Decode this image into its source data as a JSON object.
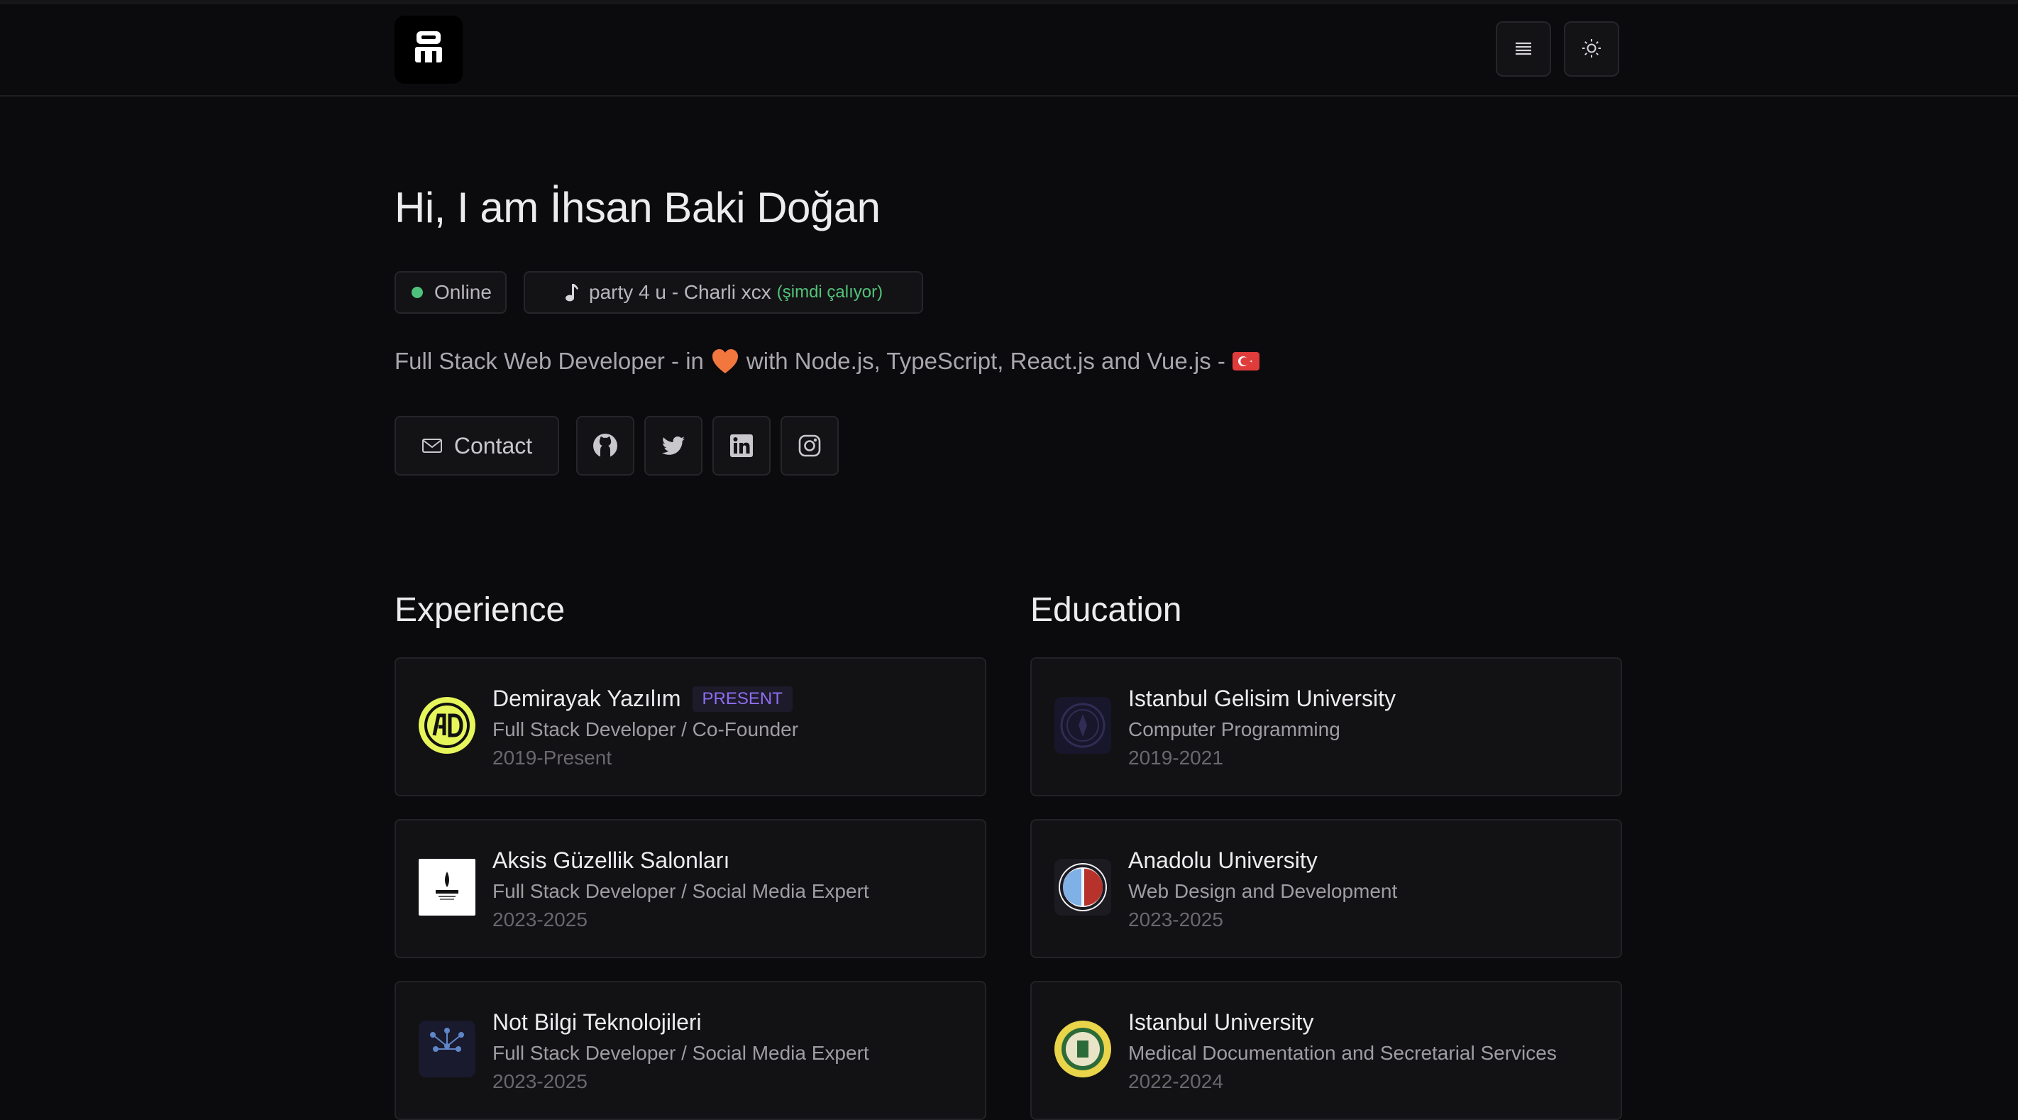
{
  "header": {
    "logo_icon": "robot-logo-icon",
    "menu_icon": "menu-icon",
    "theme_icon": "sun-icon"
  },
  "hero": {
    "title": "Hi, I am İhsan Baki Doğan",
    "status": {
      "label": "Online",
      "color": "#4ec27d"
    },
    "now_playing": {
      "track": "party 4 u - Charli xcx",
      "status": "(şimdi çalıyor)",
      "icon": "music-note-icon"
    },
    "bio": {
      "before": "Full Stack Web Developer - in",
      "heart_icon": "heart-icon",
      "after": "with Node.js, TypeScript, React.js and Vue.js -",
      "flag_icon": "turkey-flag-icon"
    },
    "contact_label": "Contact",
    "socials": [
      "github-icon",
      "twitter-icon",
      "linkedin-icon",
      "instagram-icon"
    ]
  },
  "experience": {
    "title": "Experience",
    "items": [
      {
        "name": "Demirayak Yazılım",
        "badge": "PRESENT",
        "role": "Full Stack Developer / Co-Founder",
        "years": "2019-Present"
      },
      {
        "name": "Aksis Güzellik Salonları",
        "role": "Full Stack Developer / Social Media Expert",
        "years": "2023-2025"
      },
      {
        "name": "Not Bilgi Teknolojileri",
        "role": "Full Stack Developer / Social Media Expert",
        "years": "2023-2025"
      }
    ]
  },
  "education": {
    "title": "Education",
    "items": [
      {
        "name": "Istanbul Gelisim University",
        "role": "Computer Programming",
        "years": "2019-2021"
      },
      {
        "name": "Anadolu University",
        "role": "Web Design and Development",
        "years": "2023-2025"
      },
      {
        "name": "Istanbul University",
        "role": "Medical Documentation and Secretarial Services",
        "years": "2022-2024"
      }
    ]
  },
  "colors": {
    "accent_purple": "#8f6df0",
    "online_green": "#4ec27d",
    "background": "#0b0a0c"
  }
}
